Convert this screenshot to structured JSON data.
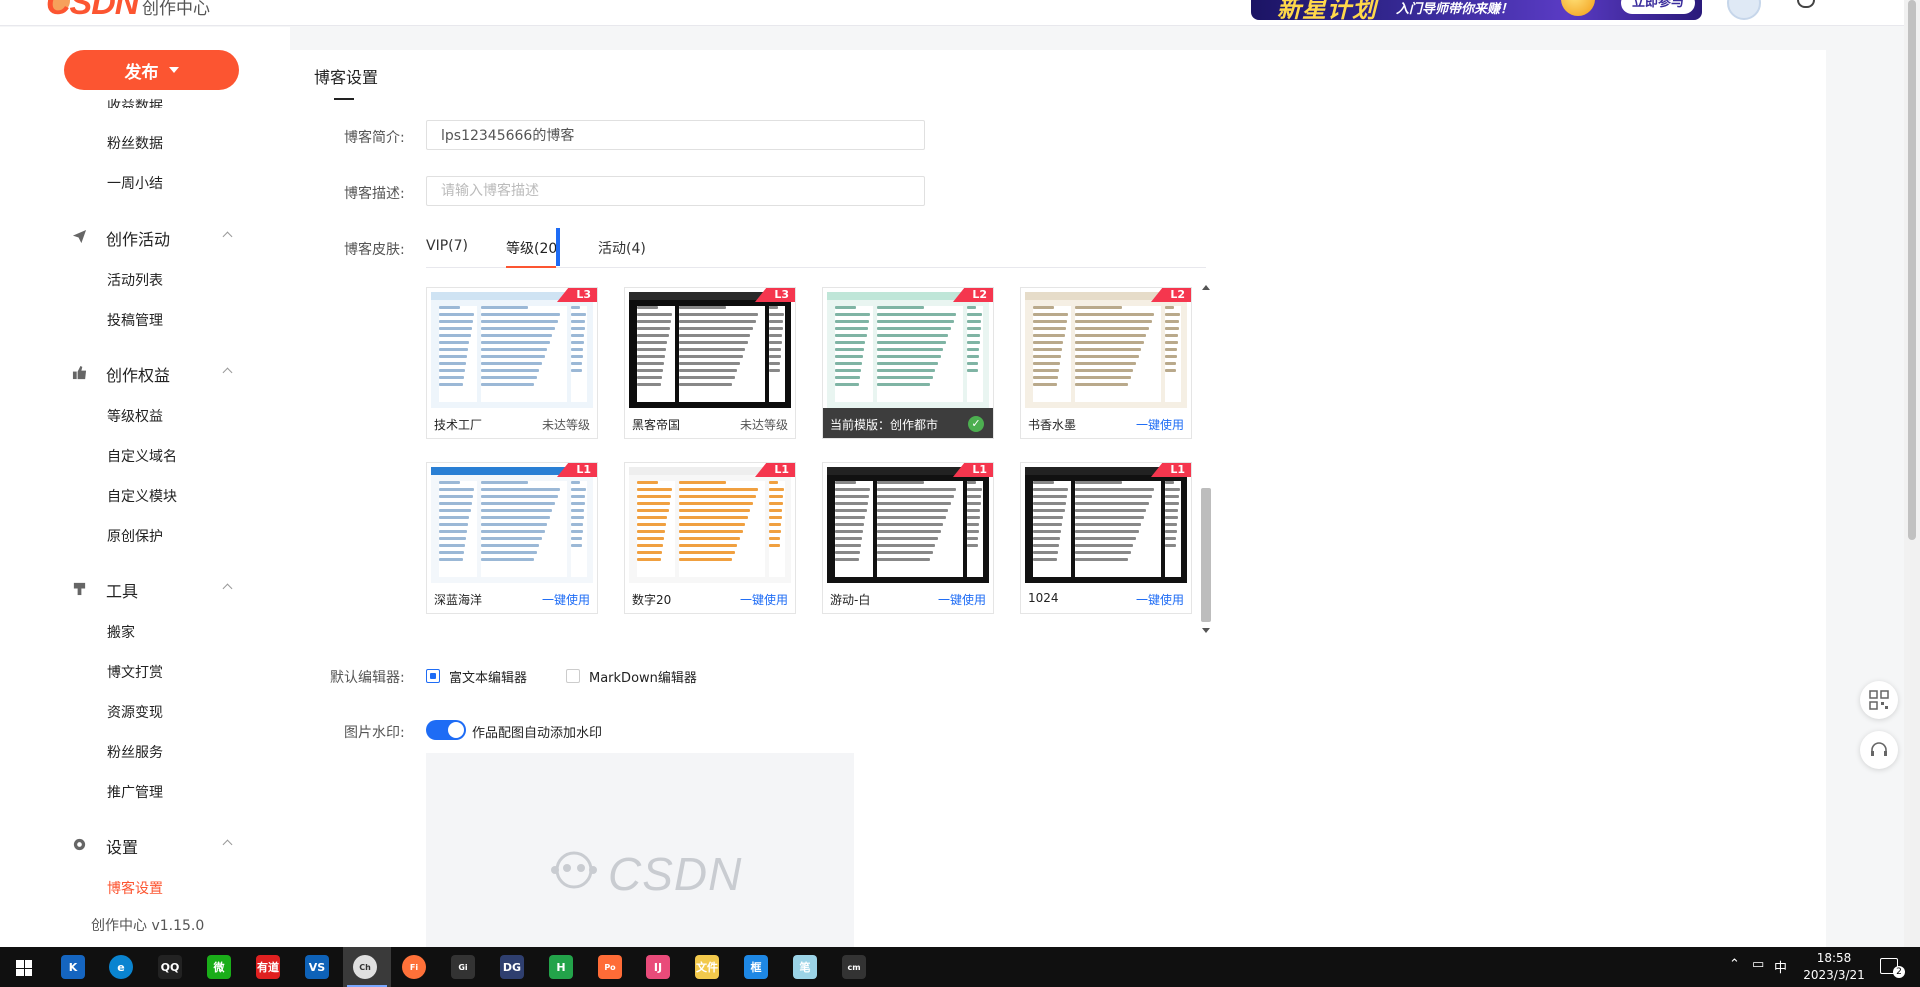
{
  "header": {
    "logo_text": "CSDN",
    "logo_sub": "创作中心",
    "banner": {
      "title": "新星计划",
      "sub": "入门导师带你来赚！",
      "button": "立即参与"
    }
  },
  "sidebar": {
    "publish_label": "发布",
    "cut_item": "收益数据",
    "groups": [
      {
        "label": "创作活动",
        "icon": "paper-plane-icon"
      },
      {
        "label": "创作权益",
        "icon": "thumbs-up-icon"
      },
      {
        "label": "工具",
        "icon": "tool-icon"
      },
      {
        "label": "设置",
        "icon": "gear-icon"
      }
    ],
    "items": [
      "粉丝数据",
      "一周小结",
      "活动列表",
      "投稿管理",
      "等级权益",
      "自定义域名",
      "自定义模块",
      "原创保护",
      "搬家",
      "博文打赏",
      "资源变现",
      "粉丝服务",
      "推广管理",
      "博客设置"
    ],
    "active_item": "博客设置",
    "version": "创作中心 v1.15.0"
  },
  "main": {
    "title": "博客设置",
    "intro": {
      "label": "博客简介:",
      "value": "lps12345666的博客"
    },
    "desc": {
      "label": "博客描述:",
      "placeholder": "请输入博客描述"
    },
    "skin": {
      "label": "博客皮肤:",
      "tabs": [
        {
          "label": "VIP(7)"
        },
        {
          "label": "等级(20)"
        },
        {
          "label": "活动(4)"
        }
      ],
      "active_tab": "等级(20)",
      "templates": [
        {
          "name": "技术工厂",
          "level": "L3",
          "action": "未达等级",
          "state": "locked",
          "theme": "light-blue"
        },
        {
          "name": "黑客帝国",
          "level": "L3",
          "action": "未达等级",
          "state": "locked",
          "theme": "dark"
        },
        {
          "name": "当前模版：创作都市",
          "level": "L2",
          "action": "",
          "state": "current",
          "theme": "teal"
        },
        {
          "name": "书香水墨",
          "level": "L2",
          "action": "一键使用",
          "state": "available",
          "theme": "ink"
        },
        {
          "name": "深蓝海洋",
          "level": "L1",
          "action": "一键使用",
          "state": "available",
          "theme": "ocean"
        },
        {
          "name": "数字20",
          "level": "L1",
          "action": "一键使用",
          "state": "available",
          "theme": "orange"
        },
        {
          "name": "游动-白",
          "level": "L1",
          "action": "一键使用",
          "state": "available",
          "theme": "black"
        },
        {
          "name": "1024",
          "level": "L1",
          "action": "一键使用",
          "state": "available",
          "theme": "black"
        }
      ]
    },
    "editor": {
      "label": "默认编辑器:",
      "options": [
        "富文本编辑器",
        "MarkDown编辑器"
      ],
      "selected": "富文本编辑器"
    },
    "watermark": {
      "label": "图片水印:",
      "toggle_text": "作品配图自动添加水印",
      "enabled": true,
      "preview_text": "CSDN"
    }
  },
  "float_buttons": [
    "qr-code-icon",
    "headset-icon"
  ],
  "taskbar": {
    "apps": [
      "K",
      "e",
      "QQ",
      "微",
      "有道",
      "VS",
      "Chrome",
      "Firefox",
      "GitHub",
      "DG",
      "H",
      "Postman",
      "IJ",
      "文件",
      "框",
      "笔",
      "cmd"
    ],
    "tray_ime": "中",
    "time": "18:58",
    "date": "2023/3/21",
    "notifications": "2"
  },
  "colors": {
    "brand": "#fc5531",
    "link": "#1e6cf5",
    "badge": "#f5364e"
  }
}
